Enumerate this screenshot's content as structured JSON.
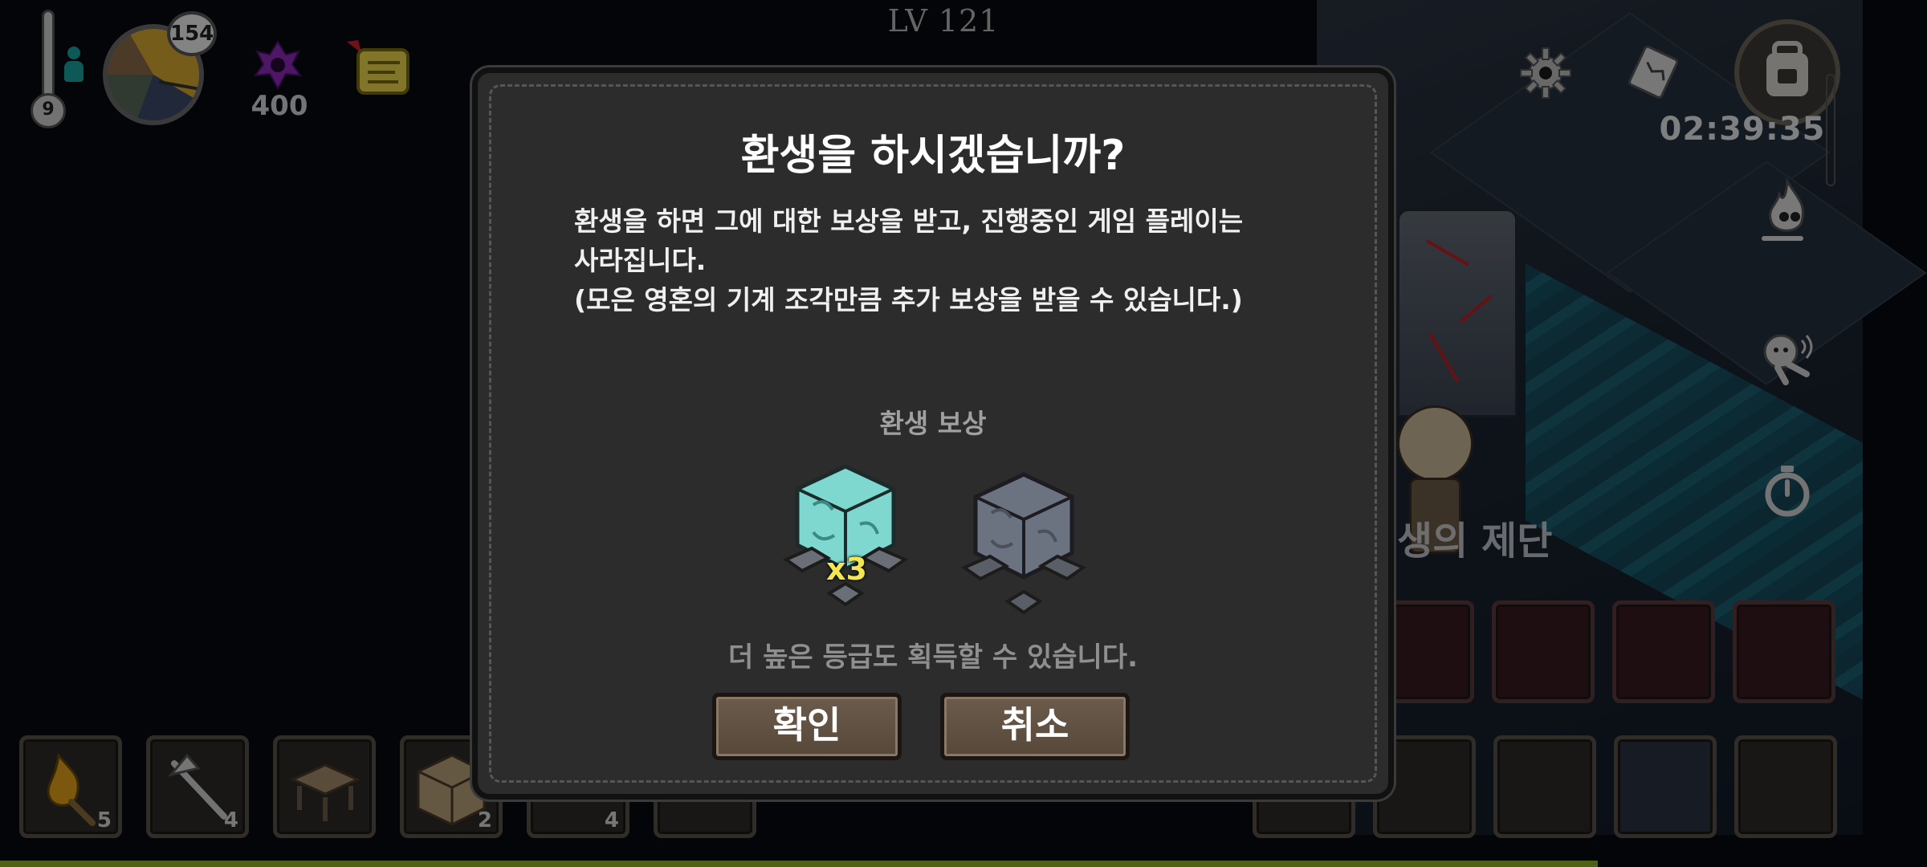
{
  "hud": {
    "temperature": "9",
    "day": "154",
    "soul_count": "400",
    "level": "LV 121",
    "timer": "02:39:35"
  },
  "world": {
    "altar_label": "생의 제단"
  },
  "dialog": {
    "title": "환생을 하시겠습니까?",
    "body_line1": "환생을 하면 그에 대한 보상을 받고, 진행중인 게임 플레이는",
    "body_line2": "사라집니다.",
    "body_line3": "(모은 영혼의 기계 조각만큼 추가 보상을 받을 수 있습니다.)",
    "reward_label": "환생 보상",
    "reward_quantity": "x3",
    "reward_note": "더 높은 등급도 획득할 수 있습니다.",
    "confirm_label": "확인",
    "cancel_label": "취소"
  },
  "hotbar": {
    "slots": [
      {
        "icon": "torch-icon",
        "count": "5"
      },
      {
        "icon": "axe-icon",
        "count": "4"
      },
      {
        "icon": "workbench-icon",
        "count": ""
      },
      {
        "icon": "chest-icon",
        "count": "2"
      },
      {
        "icon": "book-icon",
        "count": "4"
      },
      {
        "icon": "item-icon",
        "count": ""
      }
    ]
  },
  "icons": {
    "temperature": "thermometer-icon",
    "player_status": "person-icon",
    "time": "day-clock-icon",
    "souls": "soul-icon",
    "quest": "scroll-icon",
    "settings": "gear-icon",
    "map": "map-icon",
    "inventory": "backpack-icon",
    "fire_spirit": "spirit-flame-icon",
    "emote": "emote-icon",
    "speed": "stopwatch-icon"
  },
  "colors": {
    "dialog_bg": "#2c2c2c",
    "button": "#5e5040",
    "reward_qty": "#f3e650",
    "exp_bar": "#8db227"
  }
}
